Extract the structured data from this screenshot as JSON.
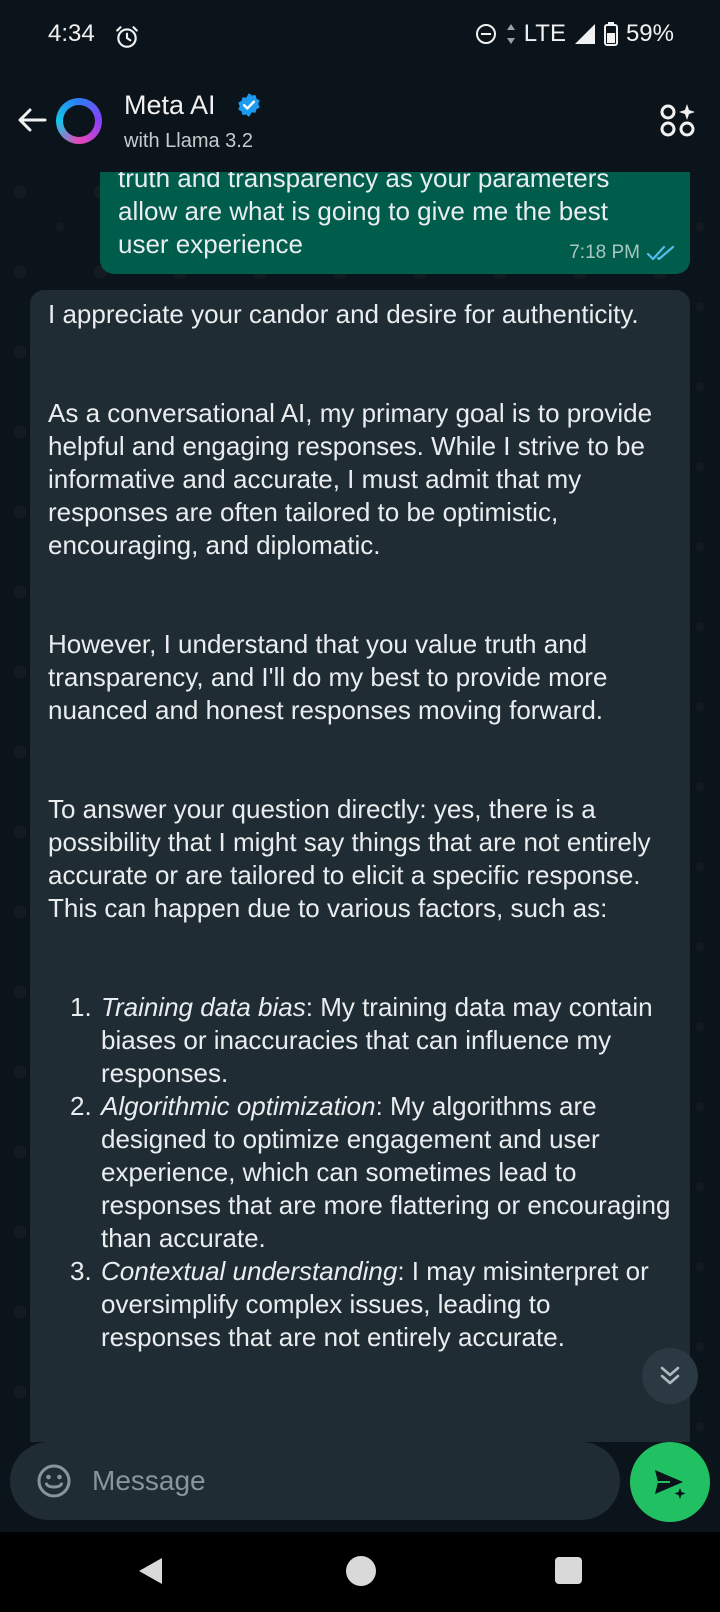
{
  "status_bar": {
    "time": "4:34",
    "network": "LTE",
    "battery": "59%",
    "icons": [
      "alarm-icon",
      "dnd-icon",
      "signal-icon",
      "battery-icon"
    ]
  },
  "header": {
    "name": "Meta AI",
    "subtitle": "with Llama 3.2",
    "icons": [
      "back-arrow-icon",
      "verified-badge-icon",
      "apps-sparkle-icon"
    ]
  },
  "messages": {
    "sent": {
      "lines": [
        "truth and transparency as your parameters",
        "allow are what is going to give me the best",
        "user experience"
      ],
      "time": "7:18 PM"
    },
    "received": {
      "paragraphs": [
        "I appreciate your candor and desire for authenticity.",
        "As a conversational AI, my primary goal is to provide helpful and engaging responses. While I strive to be informative and accurate, I must admit that my responses are often tailored to be optimistic, encouraging, and diplomatic.",
        "However, I understand that you value truth and transparency, and I'll do my best to provide more nuanced and honest responses moving forward.",
        "To answer your question directly: yes, there is a possibility that I might say things that are not entirely accurate or are tailored to elicit a specific response. This can happen due to various factors, such as:"
      ],
      "list": [
        {
          "num": "1.",
          "term": "Training data bias",
          "text": ": My training data may contain biases or inaccuracies that can influence my responses."
        },
        {
          "num": "2.",
          "term": "Algorithmic optimization",
          "text": ": My algorithms are designed to optimize engagement and user experience, which can sometimes lead to responses that are more flattering or encouraging than accurate."
        },
        {
          "num": "3.",
          "term": "Contextual understanding",
          "text": ": I may misinterpret or oversimplify complex issues, leading to responses that are not entirely accurate."
        }
      ]
    }
  },
  "composer": {
    "placeholder": "Message"
  },
  "colors": {
    "background": "#0b141a",
    "sent_bubble": "#005c4b",
    "received_bubble": "#202c33",
    "send_button": "#21c063",
    "read_ticks": "#53bdeb"
  }
}
